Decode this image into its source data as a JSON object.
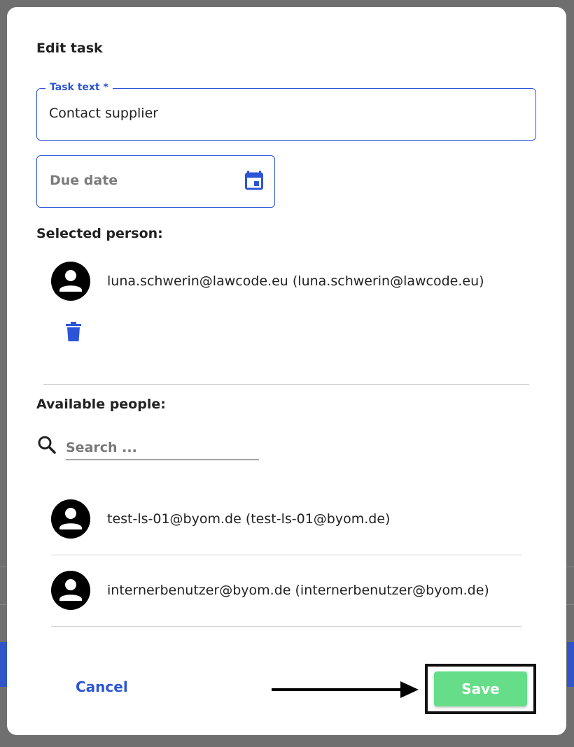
{
  "dialog": {
    "title": "Edit task",
    "task_field": {
      "label": "Task text *",
      "value": "Contact supplier"
    },
    "due_date_field": {
      "placeholder": "Due date"
    },
    "selected_section_label": "Selected person:",
    "selected_person": {
      "name": "luna.schwerin@lawcode.eu (luna.schwerin@lawcode.eu)"
    },
    "available_section_label": "Available people:",
    "search": {
      "placeholder": "Search ..."
    },
    "available_people": [
      {
        "name": "test-ls-01@byom.de (test-ls-01@byom.de)"
      },
      {
        "name": "internerbenutzer@byom.de (internerbenutzer@byom.de)"
      }
    ],
    "cancel_label": "Cancel",
    "save_label": "Save"
  },
  "colors": {
    "accent": "#2b55d6",
    "save_button": "#66dd88",
    "overlay": "#6f6f6f"
  },
  "icons": [
    "calendar-icon",
    "avatar-icon",
    "trash-icon",
    "search-icon",
    "arrow-icon"
  ]
}
